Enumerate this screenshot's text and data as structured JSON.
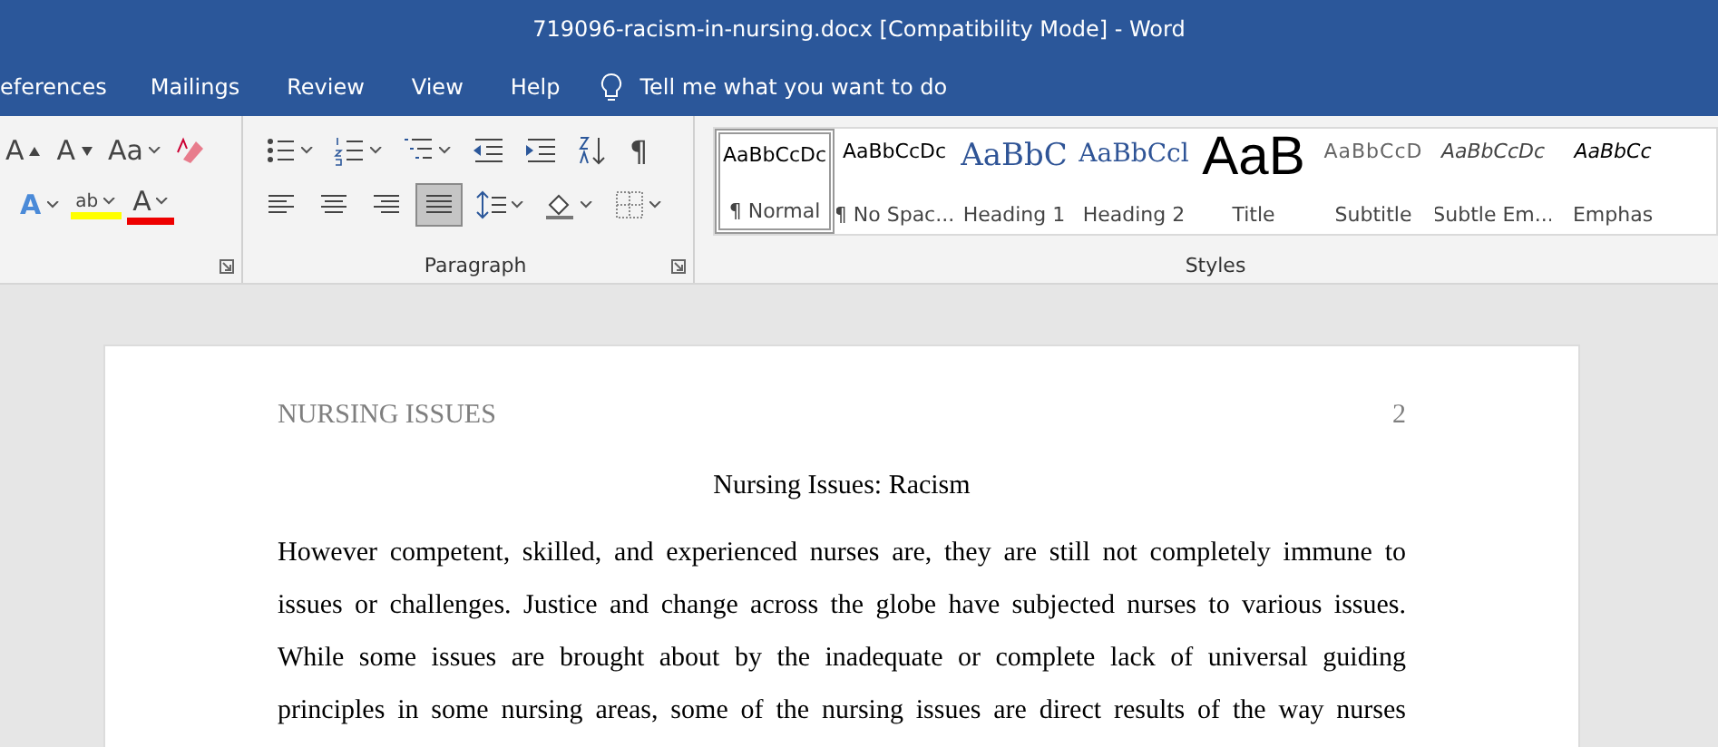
{
  "window": {
    "title": "719096-racism-in-nursing.docx [Compatibility Mode]  -  Word"
  },
  "tabs": [
    {
      "label": "eferences"
    },
    {
      "label": "Mailings"
    },
    {
      "label": "Review"
    },
    {
      "label": "View"
    },
    {
      "label": "Help"
    }
  ],
  "tell_me": {
    "placeholder": "Tell me what you want to do"
  },
  "font_group": {
    "row1": [
      {
        "kind": "grow",
        "glyph": "A"
      },
      {
        "kind": "shrink",
        "glyph": "A"
      },
      {
        "kind": "case",
        "glyph": "Aa"
      },
      {
        "kind": "clear"
      }
    ],
    "row2": [
      {
        "kind": "effects",
        "glyph": "A"
      },
      {
        "kind": "highlight",
        "glyph": "ab"
      },
      {
        "kind": "color",
        "glyph": "A"
      }
    ]
  },
  "paragraph_group": {
    "label": "Paragraph",
    "row1": [
      {
        "kind": "bullets"
      },
      {
        "kind": "numbering"
      },
      {
        "kind": "multilevel"
      },
      {
        "kind": "outdent"
      },
      {
        "kind": "indent"
      },
      {
        "kind": "sort"
      },
      {
        "kind": "pilcrow",
        "glyph": "¶"
      }
    ],
    "row2": [
      {
        "kind": "left",
        "selected": false
      },
      {
        "kind": "center",
        "selected": false
      },
      {
        "kind": "right",
        "selected": false
      },
      {
        "kind": "justify",
        "selected": true
      },
      {
        "kind": "spacing"
      },
      {
        "kind": "shading"
      },
      {
        "kind": "borders"
      }
    ]
  },
  "styles_group": {
    "label": "Styles",
    "items": [
      {
        "preview": "AaBbCcDc",
        "name": "¶ Normal",
        "kind": "normal",
        "selected": true
      },
      {
        "preview": "AaBbCcDc",
        "name": "¶ No Spac...",
        "kind": "normal",
        "selected": false
      },
      {
        "preview": "AaBbC",
        "name": "Heading 1",
        "kind": "heading1",
        "selected": false
      },
      {
        "preview": "AaBbCcl",
        "name": "Heading 2",
        "kind": "heading2",
        "selected": false
      },
      {
        "preview": "AaB",
        "name": "Title",
        "kind": "title",
        "selected": false
      },
      {
        "preview": "AaBbCcD",
        "name": "Subtitle",
        "kind": "subtitle",
        "selected": false
      },
      {
        "preview": "AaBbCcDc",
        "name": "Subtle Em...",
        "kind": "subtle",
        "selected": false
      },
      {
        "preview": "AaBbCc",
        "name": "Emphas",
        "kind": "emphasis",
        "selected": false
      }
    ]
  },
  "document": {
    "header": "NURSING ISSUES",
    "page_number": "2",
    "title": "Nursing Issues: Racism",
    "paragraph_lines": [
      "However competent, skilled, and experienced nurses are, they are still not completely immune to",
      "issues or challenges. Justice and change across the globe have subjected nurses to various issues.",
      "While some issues are brought about by the inadequate or complete lack of universal guiding",
      "principles in some nursing areas, some of the nursing issues are direct results of the way nurses"
    ]
  }
}
